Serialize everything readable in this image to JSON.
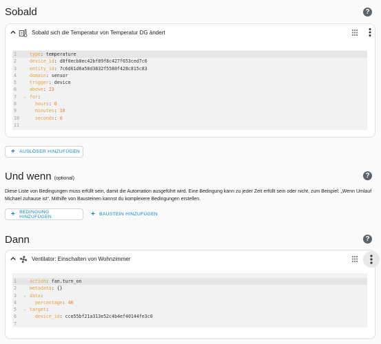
{
  "sections": {
    "trigger": {
      "title": "Sobald",
      "add_label": "AUSLÖSER HINZUFÜGEN"
    },
    "condition": {
      "title": "Und wenn",
      "optional": "(optional)",
      "description": "Diese Liste von Bedingungen muss erfüllt sein, damit die Automation ausgeführt wird. Eine Bedingung kann zu jeder Zeit erfüllt sein oder nicht, zum Beispiel: „Wenn Umlauf Michael zuhause ist“. Mithilfe von Bausteinen kannst du komplexere Bedingungen erstellen.",
      "add_condition_label": "BEDINGUNG HINZUFÜGEN",
      "add_block_label": "BAUSTEIN HINZUFÜGEN"
    },
    "action": {
      "title": "Dann"
    }
  },
  "help_icon": "?",
  "trigger_card": {
    "title": "Sobald sich die Temperatur von Temperatur DG ändert",
    "icon": "thermometer-device-icon",
    "code": [
      {
        "n": "1",
        "fold": "",
        "key": "type",
        "sep": ": ",
        "val": "temperature",
        "vtype": "val",
        "indent": ""
      },
      {
        "n": "2",
        "fold": "",
        "key": "device_id",
        "sep": ": ",
        "val": "d8f0ecb8ec42bf89f8c427f653ced7c6",
        "vtype": "val",
        "indent": ""
      },
      {
        "n": "3",
        "fold": "",
        "key": "entity_id",
        "sep": ": ",
        "val": "7c6d61d6a58d3832f5580f428c815c83",
        "vtype": "val",
        "indent": ""
      },
      {
        "n": "4",
        "fold": "",
        "key": "domain",
        "sep": ": ",
        "val": "sensor",
        "vtype": "val",
        "indent": ""
      },
      {
        "n": "5",
        "fold": "",
        "key": "trigger",
        "sep": ": ",
        "val": "device",
        "vtype": "val",
        "indent": ""
      },
      {
        "n": "6",
        "fold": "",
        "key": "above",
        "sep": ": ",
        "val": "23",
        "vtype": "num",
        "indent": ""
      },
      {
        "n": "7",
        "fold": "⌄",
        "key": "for",
        "sep": ":",
        "val": "",
        "vtype": "val",
        "indent": ""
      },
      {
        "n": "8",
        "fold": "",
        "key": "hours",
        "sep": ": ",
        "val": "0",
        "vtype": "num",
        "indent": "  "
      },
      {
        "n": "9",
        "fold": "",
        "key": "minutes",
        "sep": ": ",
        "val": "10",
        "vtype": "num",
        "indent": "  "
      },
      {
        "n": "10",
        "fold": "",
        "key": "seconds",
        "sep": ": ",
        "val": "0",
        "vtype": "num",
        "indent": "  "
      },
      {
        "n": "11",
        "fold": "",
        "key": "",
        "sep": "",
        "val": "",
        "vtype": "val",
        "indent": ""
      }
    ]
  },
  "action_card": {
    "title": "Ventilator: Einschalten von Wohnzimmer",
    "icon": "fan-icon",
    "code": [
      {
        "n": "1",
        "fold": "",
        "key": "action",
        "sep": ": ",
        "val": "fan.turn_on",
        "vtype": "val",
        "indent": ""
      },
      {
        "n": "2",
        "fold": "",
        "key": "metadata",
        "sep": ": ",
        "val": "{}",
        "vtype": "val",
        "indent": ""
      },
      {
        "n": "3",
        "fold": "⌄",
        "key": "data",
        "sep": ":",
        "val": "",
        "vtype": "val",
        "indent": ""
      },
      {
        "n": "4",
        "fold": "",
        "key": "percentage",
        "sep": ": ",
        "val": "40",
        "vtype": "num",
        "indent": "  "
      },
      {
        "n": "5",
        "fold": "⌄",
        "key": "target",
        "sep": ":",
        "val": "",
        "vtype": "val",
        "indent": ""
      },
      {
        "n": "6",
        "fold": "",
        "key": "device_id",
        "sep": ": ",
        "val": "cce55bf21a313e52c4b4ef40144fe3c0",
        "vtype": "val",
        "indent": "  "
      },
      {
        "n": "7",
        "fold": "",
        "key": "",
        "sep": "",
        "val": "",
        "vtype": "val",
        "indent": ""
      }
    ]
  },
  "colors": {
    "accent": "#0288d1",
    "yaml_key": "#e6a23c",
    "yaml_number": "#ee7b2e"
  }
}
